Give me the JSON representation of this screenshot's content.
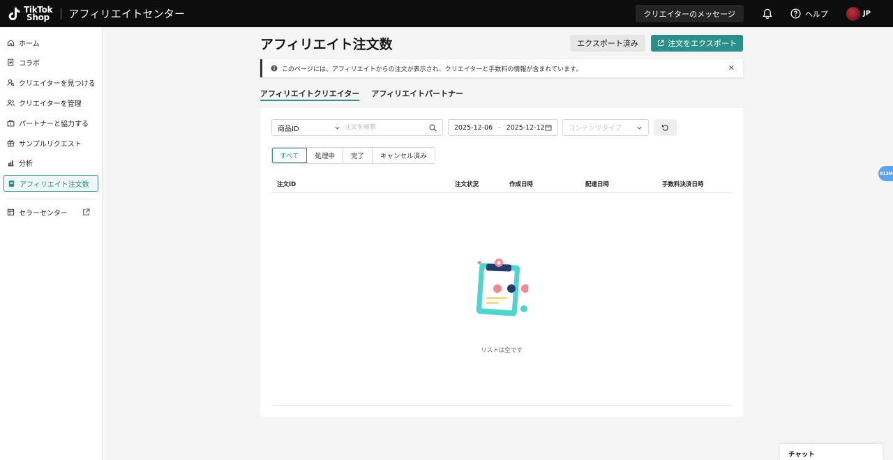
{
  "header": {
    "logo_line1": "TikTok",
    "logo_line2": "Shop",
    "app_title": "アフィリエイトセンター",
    "creator_messages": "クリエイターのメッセージ",
    "help": "ヘルプ",
    "region": "JP"
  },
  "sidebar": {
    "items": [
      {
        "label": "ホーム",
        "icon": "home-icon"
      },
      {
        "label": "コラボ",
        "icon": "document-icon"
      },
      {
        "label": "クリエイターを見つける",
        "icon": "user-search-icon"
      },
      {
        "label": "クリエイターを管理",
        "icon": "users-icon"
      },
      {
        "label": "パートナーと協力する",
        "icon": "handshake-icon"
      },
      {
        "label": "サンプルリクエスト",
        "icon": "gift-icon"
      },
      {
        "label": "分析",
        "icon": "chart-icon"
      },
      {
        "label": "アフィリエイト注文数",
        "icon": "order-icon",
        "active": true
      }
    ],
    "seller_center": "セラーセンター"
  },
  "main": {
    "page_title": "アフィリエイト注文数",
    "exported_button": "エクスポート済み",
    "export_button": "注文をエクスポート",
    "notice": "このページには、アフィリエイトからの注文が表示され、クリエイターと手数料の情報が含まれています。",
    "tabs": [
      "アフィリエイトクリエイター",
      "アフィリエイトパートナー"
    ],
    "filters": {
      "id_type": "商品ID",
      "search_placeholder": "注文を検索",
      "date_start": "2025-12-06",
      "date_separator": "-",
      "date_end": "2025-12-12",
      "content_type_placeholder": "コンテンツタイプ"
    },
    "status_tabs": [
      "すべて",
      "処理中",
      "完了",
      "キャンセル済み"
    ],
    "table_headers": [
      "注文ID",
      "注文状況",
      "作成日時",
      "配達日時",
      "手数料決済日時"
    ],
    "empty_text": "リストは空です"
  },
  "floating_badge": "813M",
  "chat": "チャット",
  "colors": {
    "accent": "#2b908a",
    "topbar": "#0d0d0d",
    "badge": "#5aa4f0"
  }
}
